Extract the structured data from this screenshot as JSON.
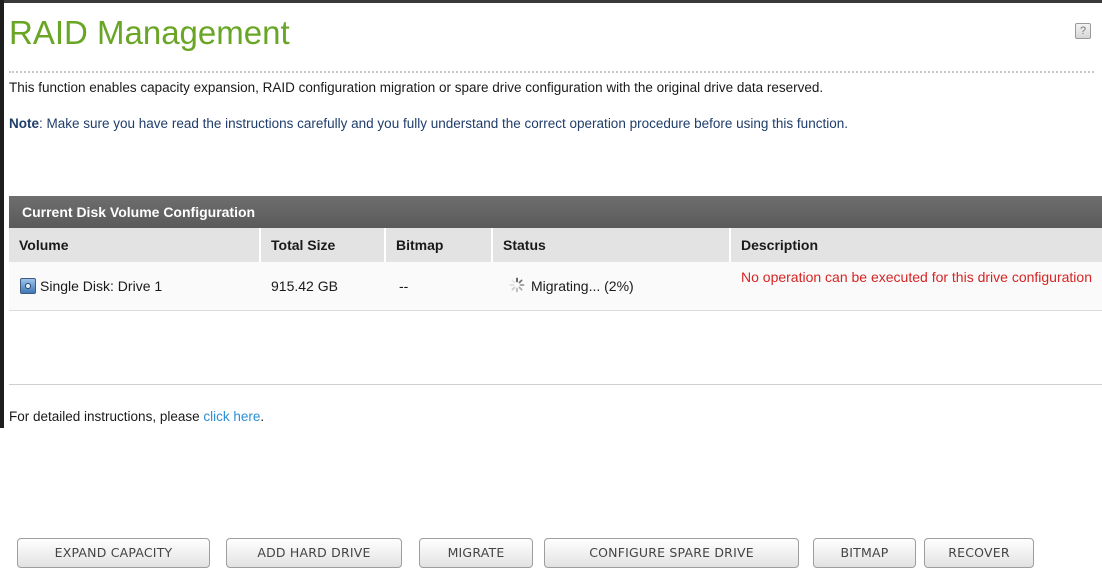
{
  "page": {
    "title": "RAID Management",
    "help_icon": "help-icon",
    "description": "This function enables capacity expansion, RAID configuration migration or spare drive configuration with the original drive data reserved.",
    "note_label": "Note",
    "note_text": ": Make sure you have read the instructions carefully and you fully understand the correct operation procedure before using this function."
  },
  "panel": {
    "header": "Current Disk Volume Configuration",
    "columns": [
      "Volume",
      "Total Size",
      "Bitmap",
      "Status",
      "Description"
    ],
    "rows": [
      {
        "volume": "Single Disk: Drive 1",
        "volume_icon": "disk-volume-icon",
        "total_size": "915.42 GB",
        "bitmap": "--",
        "status": "Migrating... (2%)",
        "status_icon": "loading-spinner-icon",
        "description": "No operation can be executed for this drive configuration"
      }
    ]
  },
  "buttons": {
    "expand": "EXPAND CAPACITY",
    "add_drive": "ADD HARD DRIVE",
    "migrate": "MIGRATE",
    "spare": "CONFIGURE SPARE DRIVE",
    "bitmap": "BITMAP",
    "recover": "RECOVER"
  },
  "footer": {
    "text": "For detailed instructions, please ",
    "link": "click here",
    "end": "."
  },
  "colors": {
    "title": "#6aa625",
    "header_bar": "#606060",
    "column_header_bg": "#e3e3e3",
    "description_error": "#d62424",
    "link": "#2a8fd6",
    "note": "#1f3d6b"
  }
}
